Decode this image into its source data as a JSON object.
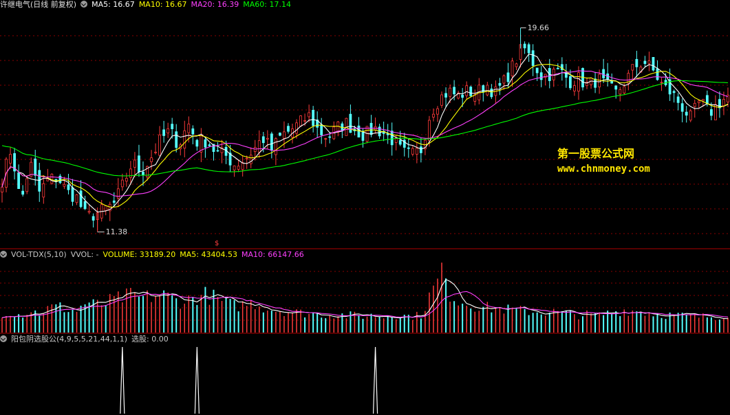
{
  "price_header": {
    "title": "许继电气(日线 前复权)",
    "ma5": "MA5: 16.67",
    "ma10": "MA10: 16.67",
    "ma20": "MA20: 16.39",
    "ma60": "MA60: 17.14"
  },
  "volume_header": {
    "title": "VOL-TDX(5,10)",
    "vvol": "VVOL: -",
    "volume": "VOLUME: 33189.20",
    "ma5": "MA5: 43404.53",
    "ma10": "MA10: 66147.66"
  },
  "signal_header": {
    "title": "阳包阴选股公(4,9,5,5,21,44,1,1)",
    "value": "选股: 0.00"
  },
  "watermark": {
    "line1": "第一股票公式网",
    "line2": "www.chnmoney.com"
  },
  "marker": "$",
  "colors": {
    "up": "#ff3b3b",
    "down": "#54ffff",
    "ma5": "#ffffff",
    "ma10": "#ffff00",
    "ma20": "#ff40ff",
    "ma60": "#00ff00",
    "grid": "#8b0000",
    "signal": "#ffffff"
  },
  "chart_data": [
    {
      "type": "candlestick",
      "title": "许继电气(日线 前复权)",
      "ylim": [
        10.7,
        20.4
      ],
      "annotations": [
        {
          "label": "19.66",
          "y": 19.66,
          "kind": "high"
        },
        {
          "label": "11.38",
          "y": 11.38,
          "kind": "low"
        }
      ],
      "series_close": [
        13.5,
        14.8,
        12.5,
        14.2,
        13.0,
        13.5,
        13.6,
        13.0,
        12.8,
        12.0,
        12.1,
        12.3,
        12.5,
        13.3,
        14.2,
        13.8,
        14.4,
        15.1,
        15.5,
        14.9,
        15.8,
        15.0,
        15.1,
        14.6,
        14.5,
        14.1,
        14.3,
        14.7,
        15.2,
        14.7,
        15.3,
        15.5,
        15.8,
        16.1,
        15.5,
        15.2,
        15.6,
        15.8,
        15.5,
        15.3,
        15.6,
        15.4,
        15.1,
        14.6,
        14.5,
        14.7,
        16.2,
        16.8,
        17.1,
        16.9,
        17.1,
        17.0,
        17.4,
        17.0,
        17.5,
        18.2,
        18.9,
        18.3,
        17.7,
        17.8,
        17.9,
        17.5,
        17.6,
        17.3,
        17.6,
        17.3,
        17.0,
        17.5,
        18.1,
        18.3,
        17.9,
        17.3,
        17.0,
        16.5,
        16.0,
        16.7,
        16.2,
        16.6,
        16.9
      ],
      "ma_lines": [
        "MA5",
        "MA10",
        "MA20",
        "MA60"
      ]
    },
    {
      "type": "bar",
      "title": "VOL-TDX(5,10)",
      "values": [
        34000,
        36000,
        30000,
        38000,
        33000,
        42000,
        45000,
        40000,
        37000,
        52000,
        47000,
        50000,
        56000,
        60000,
        64000,
        58000,
        62000,
        66000,
        60000,
        54000,
        56000,
        62000,
        65000,
        58000,
        50000,
        46000,
        48000,
        52000,
        44000,
        40000,
        38000,
        36000,
        34000,
        33000,
        32000,
        30000,
        32000,
        29000,
        30000,
        28000,
        30000,
        27000,
        31000,
        29000,
        28000,
        30000,
        65000,
        90000,
        70000,
        56000,
        50000,
        46000,
        43000,
        41000,
        40000,
        39000,
        37000,
        36000,
        35000,
        36000,
        34000,
        32000,
        30000,
        31000,
        29000,
        33000,
        36000,
        39000,
        37000,
        35000,
        33000,
        31000,
        30000,
        29000,
        28000,
        27000,
        28000,
        27500,
        33189.2
      ]
    },
    {
      "type": "bar",
      "title": "阳包阴选股公(4,9,5,5,21,44,1,1)",
      "ylim": [
        0,
        1
      ],
      "signals": [
        {
          "index": 13,
          "value": 1
        },
        {
          "index": 21,
          "value": 1
        },
        {
          "index": 40,
          "value": 1
        }
      ]
    }
  ]
}
